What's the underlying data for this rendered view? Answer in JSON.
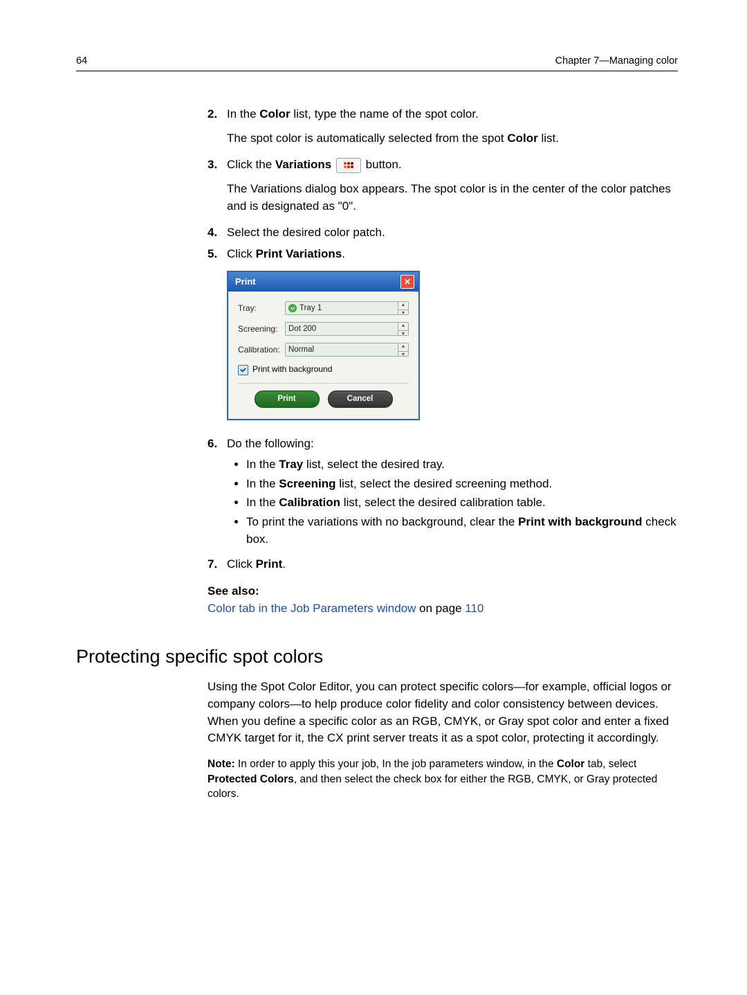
{
  "header": {
    "page_number": "64",
    "chapter": "Chapter 7—Managing color"
  },
  "steps": {
    "s2": {
      "num": "2.",
      "prefix": "In the ",
      "bold1": "Color",
      "mid1": " list, type the name of the spot color.",
      "para2a": "The spot color is automatically selected from the spot ",
      "para2b": "Color",
      "para2c": " list."
    },
    "s3": {
      "num": "3.",
      "prefix": "Click the ",
      "bold1": "Variations",
      "suffix": " button.",
      "para2": "The Variations dialog box appears. The spot color is in the center of the color patches and is designated as \"0\"."
    },
    "s4": {
      "num": "4.",
      "text": "Select the desired color patch."
    },
    "s5": {
      "num": "5.",
      "prefix": "Click ",
      "bold1": "Print Variations",
      "suffix": "."
    },
    "s6": {
      "num": "6.",
      "text": "Do the following:",
      "b1a": "In the ",
      "b1b": "Tray",
      "b1c": " list, select the desired tray.",
      "b2a": "In the ",
      "b2b": "Screening",
      "b2c": " list, select the desired screening method.",
      "b3a": "In the ",
      "b3b": "Calibration",
      "b3c": " list, select the desired calibration table.",
      "b4a": "To print the variations with no background, clear the ",
      "b4b": "Print with background",
      "b4c": " check box."
    },
    "s7": {
      "num": "7.",
      "prefix": "Click ",
      "bold1": "Print",
      "suffix": "."
    }
  },
  "see_also": {
    "heading": "See also:",
    "link_text": "Color tab in the Job Parameters window",
    "tail": " on page ",
    "page": "110"
  },
  "dialog": {
    "title": "Print",
    "tray_label": "Tray:",
    "tray_value": "Tray 1",
    "screening_label": "Screening:",
    "screening_value": "Dot 200",
    "calibration_label": "Calibration:",
    "calibration_value": "Normal",
    "checkbox_label": "Print with background",
    "print_btn": "Print",
    "cancel_btn": "Cancel"
  },
  "section": {
    "title": "Protecting specific spot colors",
    "body": "Using the Spot Color Editor, you can protect specific colors—for example, official logos or company colors—to help produce color fidelity and color consistency between devices. When you define a specific color as an RGB, CMYK, or Gray spot color and enter a fixed CMYK target for it, the CX print server treats it as a spot color, protecting it accordingly.",
    "note_bold": "Note:",
    "note_a": " In order to apply this your job, In the job parameters window, in the ",
    "note_b": "Color",
    "note_c": " tab, select ",
    "note_d": "Protected Colors",
    "note_e": ", and then select the check box for either the RGB, CMYK, or Gray protected colors."
  }
}
